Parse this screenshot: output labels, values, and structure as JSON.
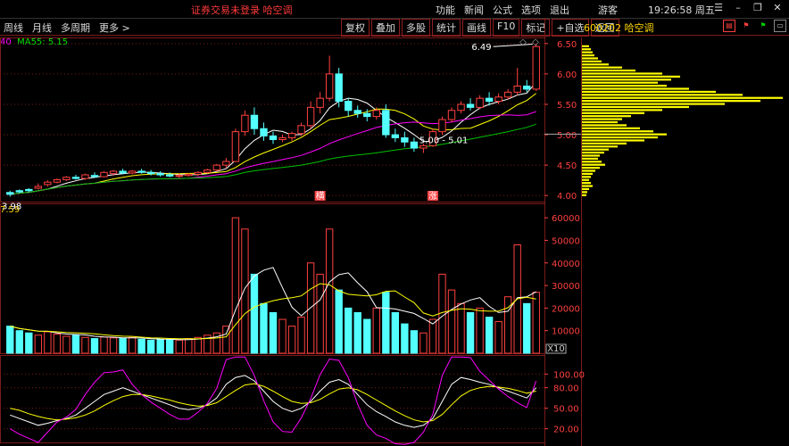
{
  "topbar": {
    "notice": "证券交易未登录   哈空调",
    "menu": [
      "功能",
      "新闻",
      "公式",
      "选项",
      "退出"
    ],
    "guest": "游客",
    "clock": "19:26:58 周五"
  },
  "toolbar": {
    "periods": [
      "周线",
      "月线",
      "多周期",
      "更多 >"
    ],
    "tools": [
      "复权",
      "叠加",
      "多股",
      "统计",
      "画线",
      "F10",
      "标记",
      "+自选",
      "返回"
    ],
    "stock": "600202 哈空调"
  },
  "main_chart": {
    "ma_label_prefix": "40",
    "ma55_label": "MA55: 5.15",
    "high_label": "6.49",
    "low_label": "3.98",
    "mid_label": "5.00 - 5.01",
    "marker_left": "横",
    "marker_right": "涨",
    "y_ticks": [
      "6.50",
      "6.00",
      "5.50",
      "5.00",
      "4.50",
      "4.00"
    ]
  },
  "volume_chart": {
    "legend": "7.59",
    "y_ticks": [
      "60000",
      "50000",
      "40000",
      "30000",
      "20000",
      "10000"
    ],
    "unit": "X10"
  },
  "kdj_chart": {
    "y_ticks": [
      "100.00",
      "80.00",
      "50.00",
      "20.00"
    ]
  },
  "colors": {
    "up": "#ff4040",
    "down": "#54ffff",
    "ma_white": "#ffffff",
    "ma_yellow": "#ffff00",
    "ma_magenta": "#ff00ff",
    "ma_green": "#00c000",
    "grid": "#7a1a1a",
    "profile": "#ffff00"
  },
  "chart_data": {
    "type": "candlestick",
    "candles": [
      [
        4.05,
        4.08,
        4.02,
        3.98
      ],
      [
        4.08,
        4.1,
        4.06,
        4.03
      ],
      [
        4.1,
        4.12,
        4.08,
        4.05
      ],
      [
        4.12,
        4.2,
        4.15,
        4.1
      ],
      [
        4.18,
        4.25,
        4.22,
        4.15
      ],
      [
        4.22,
        4.28,
        4.26,
        4.2
      ],
      [
        4.26,
        4.32,
        4.3,
        4.24
      ],
      [
        4.3,
        4.34,
        4.28,
        4.26
      ],
      [
        4.28,
        4.36,
        4.34,
        4.26
      ],
      [
        4.33,
        4.38,
        4.31,
        4.29
      ],
      [
        4.31,
        4.4,
        4.38,
        4.3
      ],
      [
        4.36,
        4.42,
        4.4,
        4.33
      ],
      [
        4.4,
        4.44,
        4.37,
        4.35
      ],
      [
        4.37,
        4.42,
        4.4,
        4.35
      ],
      [
        4.4,
        4.44,
        4.38,
        4.36
      ],
      [
        4.38,
        4.42,
        4.36,
        4.33
      ],
      [
        4.36,
        4.4,
        4.34,
        4.31
      ],
      [
        4.34,
        4.38,
        4.32,
        4.3
      ],
      [
        4.32,
        4.36,
        4.33,
        4.29
      ],
      [
        4.33,
        4.37,
        4.35,
        4.31
      ],
      [
        4.35,
        4.4,
        4.38,
        4.32
      ],
      [
        4.38,
        4.44,
        4.42,
        4.36
      ],
      [
        4.42,
        4.52,
        4.5,
        4.4
      ],
      [
        4.5,
        4.62,
        4.56,
        4.45
      ],
      [
        4.56,
        5.1,
        5.05,
        4.55
      ],
      [
        5.05,
        5.4,
        5.32,
        4.98
      ],
      [
        5.32,
        5.45,
        5.1,
        5.0
      ],
      [
        5.1,
        5.2,
        4.98,
        4.9
      ],
      [
        4.98,
        5.05,
        4.92,
        4.85
      ],
      [
        4.92,
        5.0,
        4.95,
        4.88
      ],
      [
        4.95,
        5.05,
        5.02,
        4.9
      ],
      [
        5.02,
        5.2,
        5.15,
        4.98
      ],
      [
        5.15,
        5.55,
        5.45,
        5.1
      ],
      [
        5.45,
        5.7,
        5.6,
        5.35
      ],
      [
        5.6,
        6.3,
        6.0,
        5.55
      ],
      [
        6.0,
        6.1,
        5.55,
        5.45
      ],
      [
        5.55,
        5.6,
        5.4,
        5.3
      ],
      [
        5.4,
        5.48,
        5.35,
        5.28
      ],
      [
        5.35,
        5.42,
        5.3,
        5.22
      ],
      [
        5.3,
        5.45,
        5.4,
        5.25
      ],
      [
        5.4,
        5.5,
        5.0,
        4.95
      ],
      [
        5.0,
        5.1,
        4.95,
        4.88
      ],
      [
        4.95,
        5.05,
        4.88,
        4.8
      ],
      [
        4.88,
        4.95,
        4.78,
        4.72
      ],
      [
        4.78,
        4.85,
        4.82,
        4.7
      ],
      [
        4.82,
        5.1,
        5.05,
        4.8
      ],
      [
        5.05,
        5.3,
        5.25,
        5.0
      ],
      [
        5.25,
        5.45,
        5.4,
        5.2
      ],
      [
        5.4,
        5.55,
        5.5,
        5.35
      ],
      [
        5.5,
        5.6,
        5.45,
        5.4
      ],
      [
        5.45,
        5.65,
        5.6,
        5.42
      ],
      [
        5.6,
        5.7,
        5.55,
        5.48
      ],
      [
        5.55,
        5.68,
        5.62,
        5.5
      ],
      [
        5.62,
        5.75,
        5.7,
        5.58
      ],
      [
        5.7,
        6.1,
        5.8,
        5.65
      ],
      [
        5.8,
        5.9,
        5.75,
        5.7
      ],
      [
        5.75,
        6.49,
        6.45,
        5.72
      ]
    ],
    "volume": [
      12000,
      10000,
      9000,
      8000,
      9500,
      8500,
      7500,
      8000,
      7000,
      6500,
      7200,
      6800,
      6500,
      7000,
      6200,
      5800,
      6000,
      6200,
      5800,
      6500,
      7000,
      8000,
      9000,
      12000,
      60000,
      55000,
      35000,
      22000,
      18000,
      15000,
      12000,
      16000,
      40000,
      35000,
      55000,
      28000,
      20000,
      18000,
      15000,
      20000,
      27000,
      18000,
      13000,
      10000,
      9000,
      15000,
      35000,
      28000,
      22000,
      18000,
      20000,
      16000,
      14000,
      25000,
      48000,
      22000,
      27000
    ],
    "kdj": {
      "k": [
        40,
        35,
        30,
        25,
        28,
        32,
        35,
        40,
        50,
        60,
        70,
        75,
        80,
        75,
        70,
        65,
        60,
        55,
        50,
        48,
        50,
        55,
        65,
        85,
        95,
        98,
        90,
        75,
        60,
        50,
        45,
        50,
        60,
        75,
        88,
        92,
        85,
        70,
        55,
        45,
        38,
        30,
        25,
        22,
        25,
        35,
        60,
        85,
        95,
        92,
        88,
        85,
        80,
        75,
        70,
        65,
        80
      ],
      "d": [
        50,
        47,
        42,
        38,
        35,
        33,
        34,
        36,
        40,
        46,
        54,
        61,
        67,
        70,
        70,
        68,
        65,
        62,
        58,
        55,
        53,
        54,
        58,
        67,
        76,
        84,
        86,
        82,
        75,
        67,
        60,
        57,
        58,
        63,
        71,
        78,
        80,
        77,
        70,
        62,
        54,
        46,
        39,
        33,
        30,
        32,
        41,
        55,
        68,
        76,
        80,
        82,
        81,
        79,
        76,
        72,
        75
      ],
      "j": [
        20,
        12,
        6,
        0,
        15,
        30,
        37,
        48,
        70,
        88,
        102,
        103,
        106,
        85,
        70,
        59,
        50,
        41,
        34,
        34,
        44,
        57,
        79,
        121,
        133,
        126,
        98,
        61,
        30,
        16,
        15,
        36,
        64,
        99,
        122,
        120,
        95,
        56,
        25,
        11,
        6,
        -2,
        -3,
        0,
        15,
        41,
        98,
        145,
        149,
        124,
        104,
        91,
        78,
        67,
        58,
        51,
        90
      ]
    },
    "profile": [
      [
        6.45,
        8
      ],
      [
        6.4,
        10
      ],
      [
        6.35,
        12
      ],
      [
        6.3,
        14
      ],
      [
        6.25,
        18
      ],
      [
        6.2,
        22
      ],
      [
        6.15,
        30
      ],
      [
        6.1,
        45
      ],
      [
        6.05,
        60
      ],
      [
        6.0,
        90
      ],
      [
        5.95,
        110
      ],
      [
        5.9,
        100
      ],
      [
        5.85,
        85
      ],
      [
        5.8,
        95
      ],
      [
        5.75,
        120
      ],
      [
        5.7,
        150
      ],
      [
        5.65,
        180
      ],
      [
        5.6,
        225
      ],
      [
        5.55,
        200
      ],
      [
        5.5,
        160
      ],
      [
        5.45,
        120
      ],
      [
        5.4,
        90
      ],
      [
        5.35,
        70
      ],
      [
        5.3,
        55
      ],
      [
        5.25,
        45
      ],
      [
        5.2,
        40
      ],
      [
        5.15,
        50
      ],
      [
        5.1,
        65
      ],
      [
        5.05,
        80
      ],
      [
        5.0,
        95
      ],
      [
        4.95,
        85
      ],
      [
        4.9,
        70
      ],
      [
        4.85,
        50
      ],
      [
        4.8,
        40
      ],
      [
        4.75,
        30
      ],
      [
        4.7,
        25
      ],
      [
        4.65,
        20
      ],
      [
        4.6,
        18
      ],
      [
        4.55,
        22
      ],
      [
        4.5,
        26
      ],
      [
        4.45,
        20
      ],
      [
        4.4,
        15
      ],
      [
        4.35,
        12
      ],
      [
        4.3,
        10
      ],
      [
        4.25,
        8
      ],
      [
        4.2,
        10
      ],
      [
        4.15,
        12
      ],
      [
        4.1,
        8
      ],
      [
        4.05,
        6
      ],
      [
        4.0,
        5
      ]
    ]
  }
}
